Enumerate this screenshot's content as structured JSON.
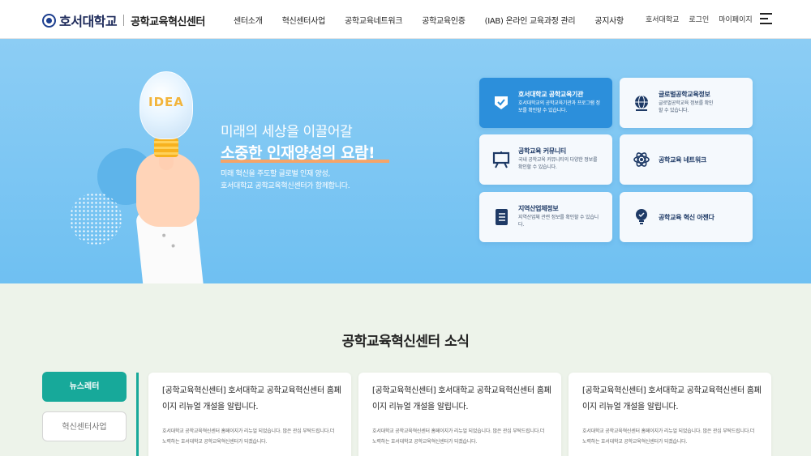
{
  "header": {
    "logo_univ": "호서대학교",
    "logo_center": "공학교육혁신센터",
    "nav": [
      "센터소개",
      "혁신센터사업",
      "공학교육네트워크",
      "공학교육인증",
      "(IAB) 온라인 교육과정 관리",
      "공지사항"
    ],
    "util": [
      "호서대학교",
      "로그인",
      "마이페이지"
    ],
    "menu_icon": "hamburger-icon"
  },
  "hero": {
    "line1": "미래의 세상을 이끌어갈",
    "line2": "소중한 인재양성의 요람!",
    "desc_line1": "미래 혁신을 주도할 글로벌 인재 양성,",
    "desc_line2": "호서대학교 공학교육혁신센터가 함께합니다.",
    "bulb_text": "IDEA",
    "accent_color": "#f5a468"
  },
  "quick_links": [
    {
      "title": "호서대학교 공학교육기관",
      "desc": "호서대학교의 공학교육기관과 프로그램 정보를 확인할 수 있습니다.",
      "icon": "check-shield-icon",
      "active": true
    },
    {
      "title": "글로벌공학교육정보",
      "desc": "글로벌공학교육 정보를 확인할 수 있습니다.",
      "icon": "globe-icon",
      "active": false
    },
    {
      "title": "공학교육 커뮤니티",
      "desc": "국내 공학교육 커뮤니티의 다양한 정보를 확인할 수 있습니다.",
      "icon": "presentation-board-icon",
      "active": false
    },
    {
      "title": "공학교육 네트워크",
      "desc": "",
      "icon": "atom-network-icon",
      "active": false
    },
    {
      "title": "지역산업체정보",
      "desc": "지역산업체 관련 정보를 확인할 수 있습니다.",
      "icon": "document-list-icon",
      "active": false
    },
    {
      "title": "공학교육 혁신 아젠다",
      "desc": "",
      "icon": "lightbulb-icon",
      "active": false
    }
  ],
  "news": {
    "title": "공학교육혁신센터 소식",
    "tabs": [
      "뉴스레터",
      "혁신센터사업"
    ],
    "cards": [
      {
        "title": "[공학교육혁신센터] 호서대학교 공학교육혁신센터 홈페이지 리뉴얼 개설을 알립니다.",
        "body": "호서대학교 공학교육혁신센터 홈페이지가 리뉴얼 되었습니다. 많은 관심 부탁드립니다.더 노력하는 호서대학교 공학교육혁신센터가 되겠습니다."
      },
      {
        "title": "[공학교육혁신센터] 호서대학교 공학교육혁신센터 홈페이지 리뉴얼 개설을 알립니다.",
        "body": "호서대학교 공학교육혁신센터 홈페이지가 리뉴얼 되었습니다. 많은 관심 부탁드립니다.더 노력하는 호서대학교 공학교육혁신센터가 되겠습니다."
      },
      {
        "title": "[공학교육혁신센터] 호서대학교 공학교육혁신센터 홈페이지 리뉴얼 개설을 알립니다.",
        "body": "호서대학교 공학교육혁신센터 홈페이지가 리뉴얼 되었습니다. 많은 관심 부탁드립니다.더 노력하는 호서대학교 공학교육혁신센터가 되겠습니다."
      }
    ],
    "accent_color": "#17a99a"
  }
}
